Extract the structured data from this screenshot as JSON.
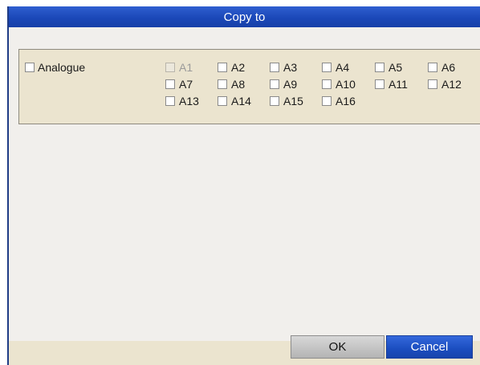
{
  "dialog": {
    "title": "Copy to",
    "group_label": "Analogue",
    "channels": [
      {
        "label": "A1",
        "enabled": false
      },
      {
        "label": "A2",
        "enabled": true
      },
      {
        "label": "A3",
        "enabled": true
      },
      {
        "label": "A4",
        "enabled": true
      },
      {
        "label": "A5",
        "enabled": true
      },
      {
        "label": "A6",
        "enabled": true
      },
      {
        "label": "A7",
        "enabled": true
      },
      {
        "label": "A8",
        "enabled": true
      },
      {
        "label": "A9",
        "enabled": true
      },
      {
        "label": "A10",
        "enabled": true
      },
      {
        "label": "A11",
        "enabled": true
      },
      {
        "label": "A12",
        "enabled": true
      },
      {
        "label": "A13",
        "enabled": true
      },
      {
        "label": "A14",
        "enabled": true
      },
      {
        "label": "A15",
        "enabled": true
      },
      {
        "label": "A16",
        "enabled": true
      }
    ],
    "ok_label": "OK",
    "cancel_label": "Cancel"
  },
  "colors": {
    "title_bar": "#1b48b8",
    "panel_background": "#ebe4cf",
    "dialog_background": "#f1efec",
    "selected_button": "#1b4dbf"
  }
}
